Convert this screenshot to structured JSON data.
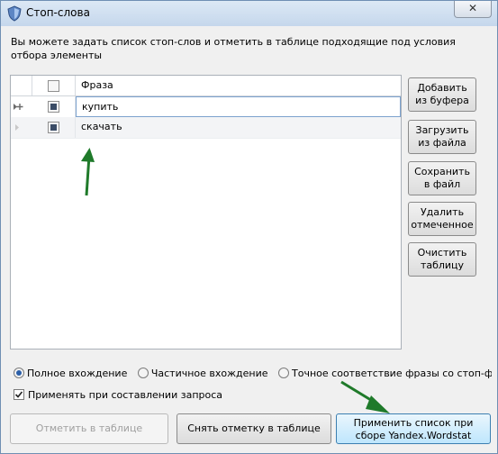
{
  "window": {
    "title": "Стоп-слова",
    "close_glyph": "✕",
    "accent": "#6f8fb3"
  },
  "intro": "Вы можете задать список стоп-слов и отметить в таблице подходящие под условия отбора элементы",
  "grid": {
    "columns": {
      "phrase": "Фраза"
    },
    "rows": [
      {
        "phrase": "купить",
        "checked": true
      },
      {
        "phrase": "скачать",
        "checked": true
      }
    ]
  },
  "side_buttons": [
    {
      "line1": "Добавить",
      "line2": "из буфера"
    },
    {
      "line1": "Загрузить",
      "line2": "из файла"
    },
    {
      "line1": "Сохранить",
      "line2": "в файл"
    },
    {
      "line1": "Удалить",
      "line2": "отмеченное"
    },
    {
      "line1": "Очистить",
      "line2": "таблицу"
    }
  ],
  "match_options": [
    {
      "label": "Полное вхождение",
      "selected": true
    },
    {
      "label": "Частичное вхождение",
      "selected": false
    },
    {
      "label": "Точное соответствие фразы со стоп-фразой",
      "selected": false
    }
  ],
  "apply_on_query": {
    "label": "Применять при составлении запроса",
    "checked": true
  },
  "bottom_buttons": {
    "mark": "Отметить в таблице",
    "unmark": "Снять отметку в таблице",
    "apply_line1": "Применить список при",
    "apply_line2": "сборе Yandex.Wordstat"
  },
  "annotation_color": "#1f7a2a"
}
